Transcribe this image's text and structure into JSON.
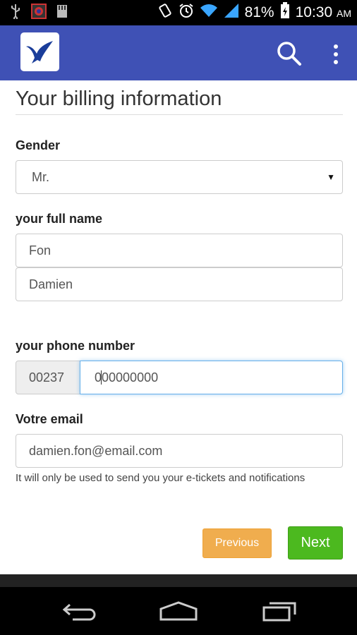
{
  "status_bar": {
    "battery": "81%",
    "time": "10:30",
    "ampm": "AM",
    "icons": [
      "usb-icon",
      "app-notification-icon",
      "sd-card-icon",
      "rotate-icon",
      "alarm-icon",
      "wifi-icon",
      "signal-icon",
      "battery-icon"
    ]
  },
  "app_bar": {
    "color": "#3f51b5",
    "logo": "bird-logo",
    "actions": [
      "search-icon",
      "more-vertical-icon"
    ]
  },
  "form": {
    "title": "Your billing information",
    "gender": {
      "label": "Gender",
      "value": "Mr."
    },
    "name": {
      "label": "your full name",
      "last_name": "Fon",
      "first_name": "Damien"
    },
    "phone": {
      "label": "your phone number",
      "prefix": "00237",
      "value_before_caret": "0",
      "value_after_caret": "00000000"
    },
    "email": {
      "label": "Votre email",
      "value": "damien.fon@email.com",
      "help": "It will only be used to send you your e-tickets and notifications"
    },
    "buttons": {
      "previous": "Previous",
      "next": "Next"
    }
  },
  "colors": {
    "previous": "#f0ad4e",
    "next": "#4cb91f",
    "focus": "#66afe9"
  },
  "nav_bar": [
    "back-icon",
    "home-icon",
    "recent-apps-icon"
  ]
}
